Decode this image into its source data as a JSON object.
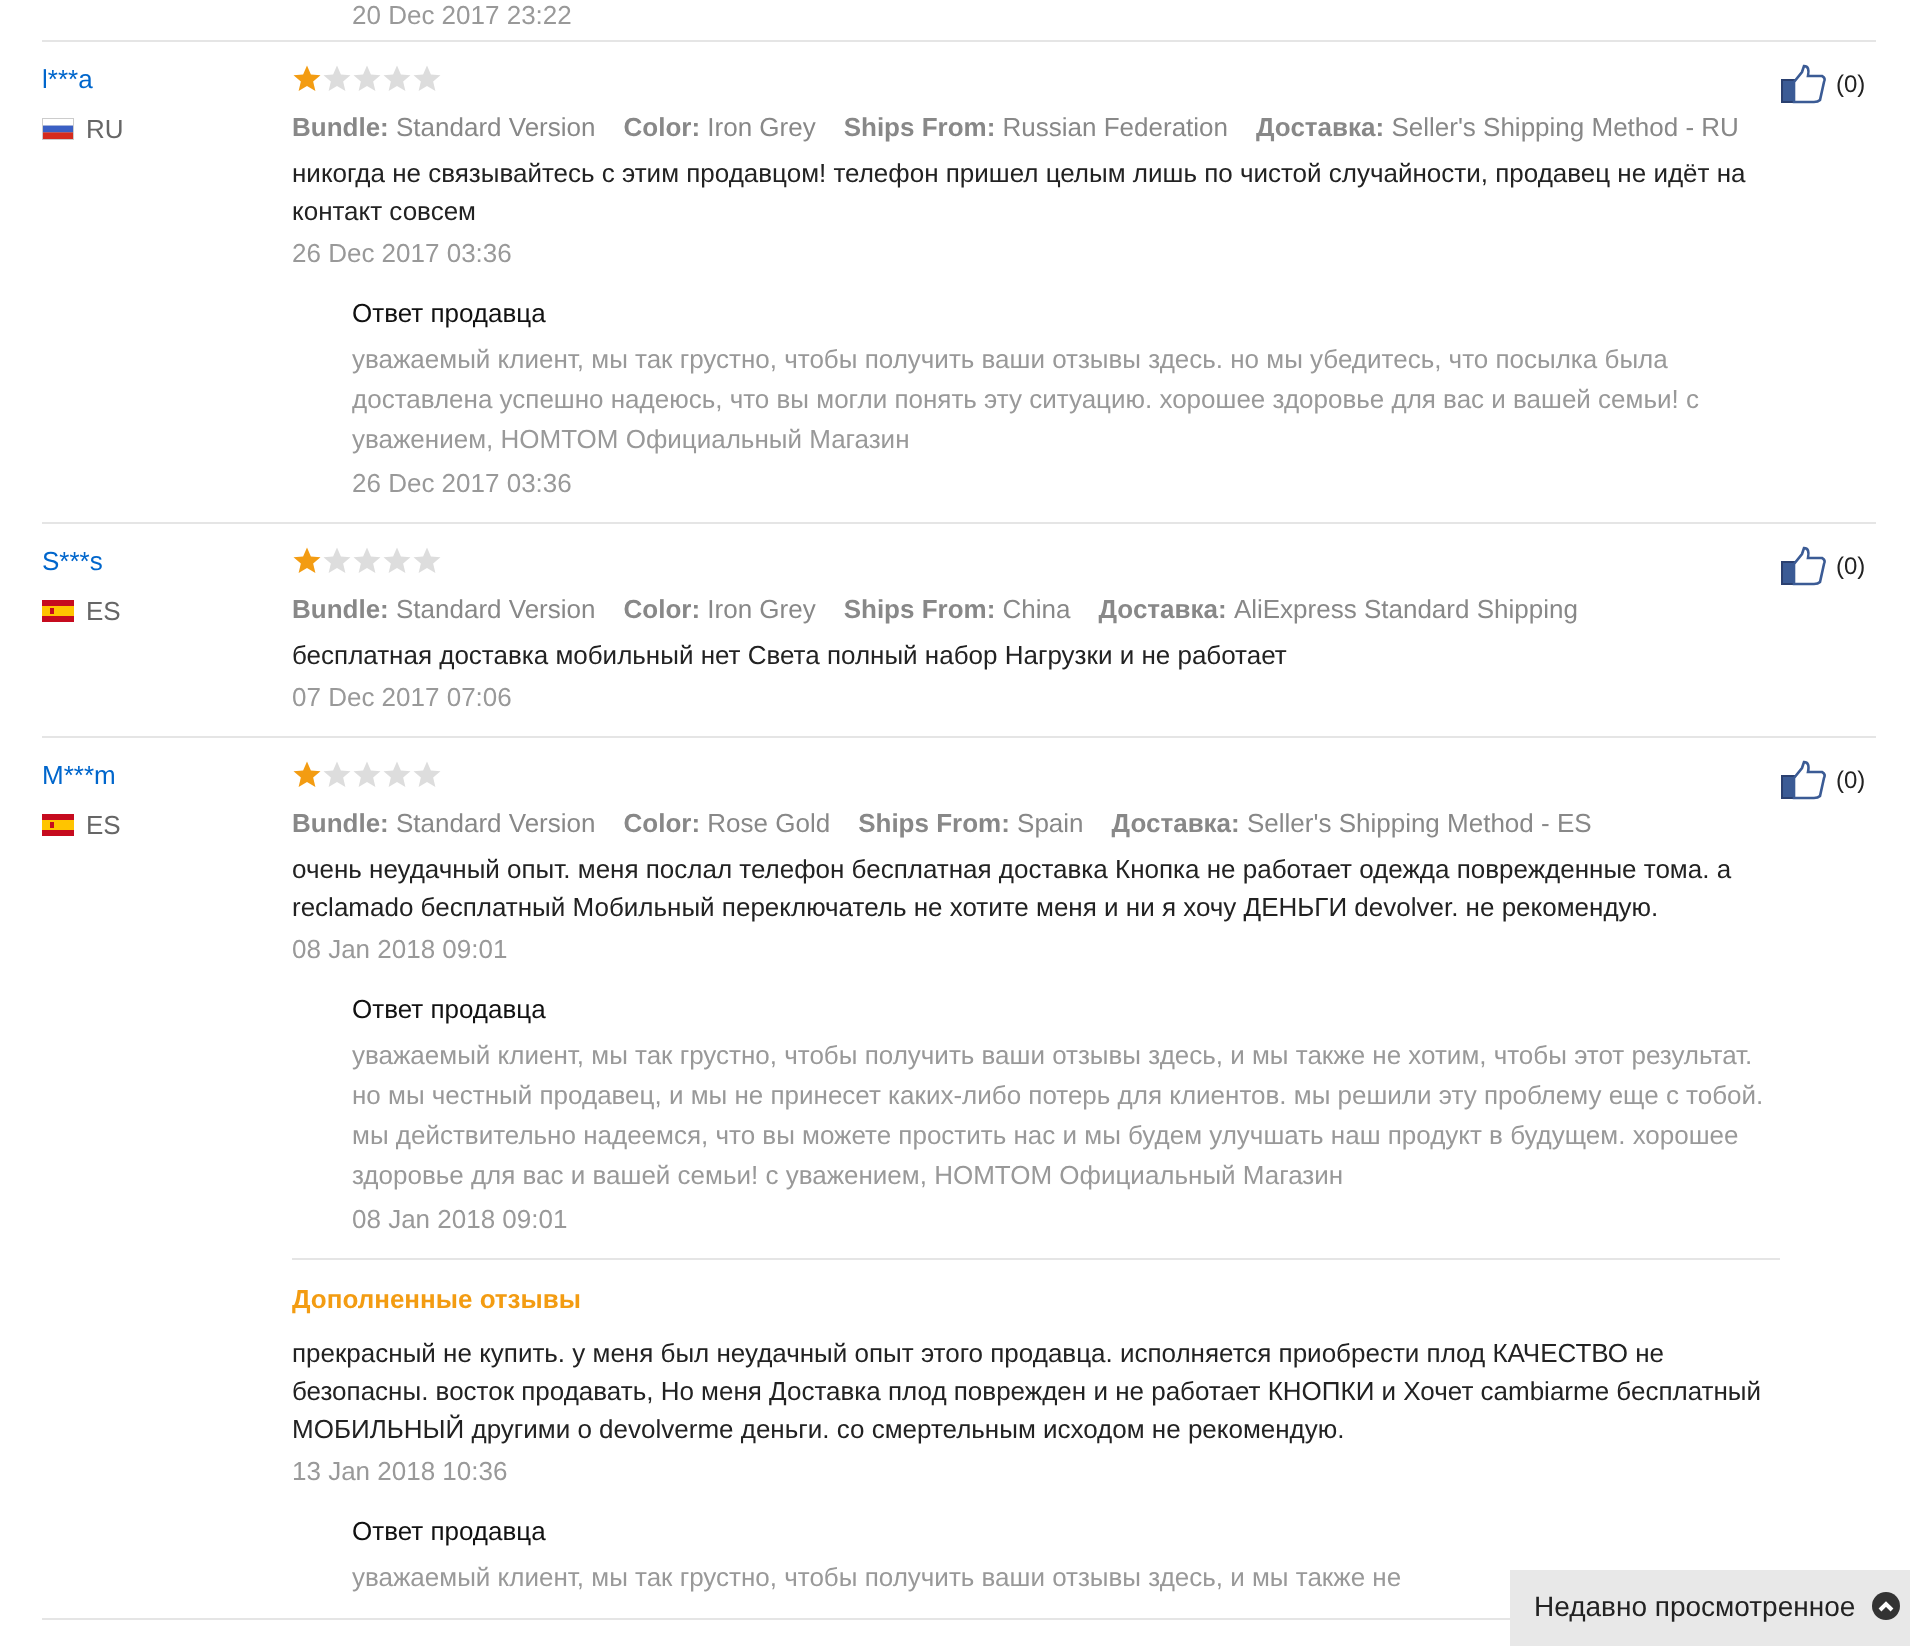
{
  "top_date": "20 Dec 2017 23:22",
  "reviews": [
    {
      "user": "l***a",
      "kind": "ru",
      "country": "RU",
      "stars": 1,
      "likes": "(0)",
      "attributes": [
        {
          "label": "Bundle:",
          "value": "Standard Version"
        },
        {
          "label": "Color:",
          "value": "Iron Grey"
        },
        {
          "label": "Ships From:",
          "value": "Russian Federation"
        },
        {
          "label": "Доставка:",
          "value": "Seller's Shipping Method - RU"
        }
      ],
      "text": "никогда не связывайтесь с этим продавцом! телефон пришел целым лишь по чистой случайности, продавец не идёт на контакт совсем",
      "date": "26 Dec 2017 03:36",
      "seller_reply": {
        "title": "Ответ продавца",
        "text": "уважаемый клиент, мы так грустно, чтобы получить ваши отзывы здесь. но мы убедитесь, что посылка была доставлена успешно надеюсь, что вы могли понять эту ситуацию. хорошее здоровье для вас и вашей семьи! с уважением, HOMTOM Официальный Магазин",
        "date": "26 Dec 2017 03:36"
      }
    },
    {
      "user": "S***s",
      "kind": "es",
      "country": "ES",
      "stars": 1,
      "likes": "(0)",
      "attributes": [
        {
          "label": "Bundle:",
          "value": "Standard Version"
        },
        {
          "label": "Color:",
          "value": "Iron Grey"
        },
        {
          "label": "Ships From:",
          "value": "China"
        },
        {
          "label": "Доставка:",
          "value": "AliExpress Standard Shipping"
        }
      ],
      "text": "бесплатная доставка мобильный нет Света полный набор Нагрузки и не работает",
      "date": "07 Dec 2017 07:06"
    },
    {
      "user": "M***m",
      "kind": "es",
      "country": "ES",
      "stars": 1,
      "likes": "(0)",
      "attributes": [
        {
          "label": "Bundle:",
          "value": "Standard Version"
        },
        {
          "label": "Color:",
          "value": "Rose Gold"
        },
        {
          "label": "Ships From:",
          "value": "Spain"
        },
        {
          "label": "Доставка:",
          "value": "Seller's Shipping Method - ES"
        }
      ],
      "text": "очень неудачный опыт. меня послал телефон бесплатная доставка Кнопка не работает одежда поврежденные тома. а reclamado бесплатный Мобильный переключатель не хотите меня и ни я хочу ДЕНЬГИ devolver. не рекомендую.",
      "date": "08 Jan 2018 09:01",
      "seller_reply": {
        "title": "Ответ продавца",
        "text": "уважаемый клиент, мы так грустно, чтобы получить ваши отзывы здесь, и мы также не хотим, чтобы этот результат. но мы честный продавец, и мы не принесет каких-либо потерь для клиентов. мы решили эту проблему еще с тобой. мы действительно надеемся, что вы можете простить нас и мы будем улучшать наш продукт в будущем. хорошее здоровье для вас и вашей семьи! с уважением, HOMTOM Официальный Магазин",
        "date": "08 Jan 2018 09:01"
      },
      "additional": {
        "title": "Дополненные отзывы",
        "text": "прекрасный не купить. у меня был неудачный опыт этого продавца. исполняется приобрести плод КАЧЕСТВО не безопасны. восток продавать, Но меня Доставка плод поврежден и не работает КНОПКИ и Хочет cambiarme бесплатный МОБИЛЬНЫЙ другими о devolverme деньги. со смертельным исходом не рекомендую.",
        "date": "13 Jan 2018 10:36",
        "seller_reply": {
          "title": "Ответ продавца",
          "text": "уважаемый клиент, мы так грустно, чтобы получить ваши отзывы здесь, и мы также не"
        }
      }
    }
  ],
  "recently_viewed": {
    "label": "Недавно просмотренное"
  }
}
